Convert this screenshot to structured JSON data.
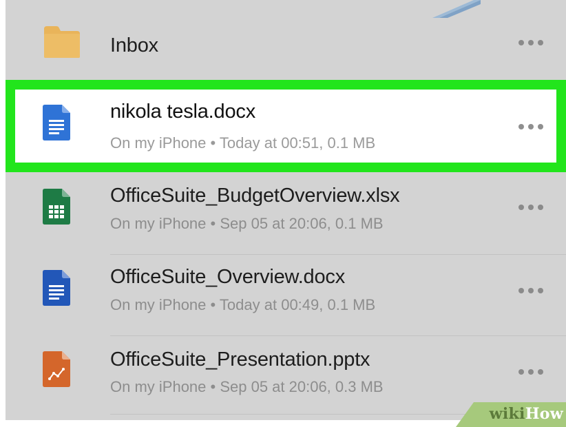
{
  "files": [
    {
      "name": "Inbox",
      "meta": "",
      "icon": "folder-icon",
      "color": "#e9b45a",
      "selected": false
    },
    {
      "name": "nikola tesla.docx",
      "meta": "On my iPhone • Today at 00:51, 0.1 MB",
      "icon": "docx-icon",
      "color": "#2f73d6",
      "selected": true
    },
    {
      "name": "OfficeSuite_BudgetOverview.xlsx",
      "meta": "On my iPhone • Sep 05 at 20:06, 0.1 MB",
      "icon": "xlsx-icon",
      "color": "#1e7b45",
      "selected": false
    },
    {
      "name": "OfficeSuite_Overview.docx",
      "meta": "On my iPhone • Today at 00:49, 0.1 MB",
      "icon": "docx-icon",
      "color": "#2257b8",
      "selected": false
    },
    {
      "name": "OfficeSuite_Presentation.pptx",
      "meta": "On my iPhone • Sep 05 at 20:06, 0.3 MB",
      "icon": "pptx-icon",
      "color": "#d4662b",
      "selected": false
    }
  ],
  "highlight_color": "#22e51c",
  "watermark": {
    "part1": "wiki",
    "part2": "How"
  }
}
